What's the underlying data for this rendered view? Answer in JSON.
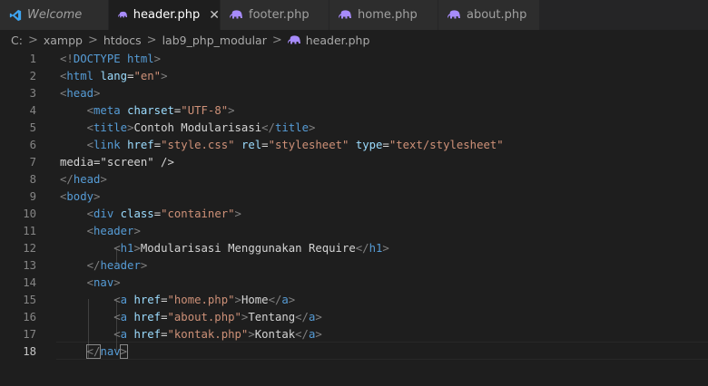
{
  "tabs": [
    {
      "label": "Welcome",
      "icon": "vscode-icon",
      "active": false,
      "italic": true
    },
    {
      "label": "header.php",
      "icon": "php-elephant-icon",
      "active": true
    },
    {
      "label": "footer.php",
      "icon": "php-elephant-icon",
      "active": false
    },
    {
      "label": "home.php",
      "icon": "php-elephant-icon",
      "active": false
    },
    {
      "label": "about.php",
      "icon": "php-elephant-icon",
      "active": false
    }
  ],
  "tab_close_glyph": "✕",
  "breadcrumb": [
    "C:",
    "xampp",
    "htdocs",
    "lab9_php_modular",
    "header.php"
  ],
  "breadcrumb_sep": ">",
  "colors": {
    "tag": "#569cd6",
    "attr": "#9cdcfe",
    "string": "#ce9178",
    "punct": "#808080",
    "text": "#d4d4d4",
    "background": "#1e1e1e",
    "accent_icon": "#3ea4f0"
  },
  "lines": [
    {
      "n": "1",
      "code": "<!DOCTYPE html>"
    },
    {
      "n": "2",
      "code": "<html lang=\"en\">"
    },
    {
      "n": "3",
      "code": "<head>"
    },
    {
      "n": "4",
      "code": "    <meta charset=\"UTF-8\">"
    },
    {
      "n": "5",
      "code": "    <title>Contoh Modularisasi</title>"
    },
    {
      "n": "6",
      "code": "    <link href=\"style.css\" rel=\"stylesheet\" type=\"text/stylesheet\""
    },
    {
      "n": "7",
      "code": "media=\"screen\" />"
    },
    {
      "n": "8",
      "code": "</head>"
    },
    {
      "n": "9",
      "code": "<body>"
    },
    {
      "n": "10",
      "code": "    <div class=\"container\">"
    },
    {
      "n": "11",
      "code": "    <header>"
    },
    {
      "n": "12",
      "code": "        <h1>Modularisasi Menggunakan Require</h1>"
    },
    {
      "n": "13",
      "code": "    </header>"
    },
    {
      "n": "14",
      "code": "    <nav>"
    },
    {
      "n": "15",
      "code": "        <a href=\"home.php\">Home</a>"
    },
    {
      "n": "16",
      "code": "        <a href=\"about.php\">Tentang</a>"
    },
    {
      "n": "17",
      "code": "        <a href=\"kontak.php\">Kontak</a>"
    },
    {
      "n": "18",
      "code": "    </nav>"
    }
  ],
  "current_line": "18"
}
